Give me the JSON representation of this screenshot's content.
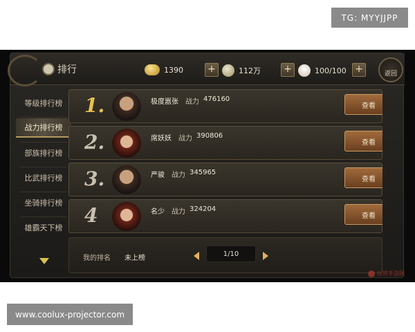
{
  "watermarks": {
    "top": "TG: MYYJJPP",
    "bottom": "www.coolux-projector.com"
  },
  "header": {
    "title": "排行",
    "back_label": "返回"
  },
  "resources": [
    {
      "icon": "gold-ingot-icon",
      "value": "1390"
    },
    {
      "icon": "coin-icon",
      "value": "112万"
    },
    {
      "icon": "bun-icon",
      "value": "100/100"
    }
  ],
  "plus_symbol": "+",
  "sidebar": {
    "items": [
      {
        "label": "等级排行榜",
        "active": false
      },
      {
        "label": "战力排行榜",
        "active": true
      },
      {
        "label": "部族排行榜",
        "active": false
      },
      {
        "label": "比武排行榜",
        "active": false
      },
      {
        "label": "坐骑排行榜",
        "active": false
      },
      {
        "label": "雄霸天下榜",
        "active": false
      }
    ]
  },
  "ranking": {
    "power_label": "战力",
    "view_label": "查看",
    "rows": [
      {
        "rank": "1.",
        "name": "极度嚣张",
        "power": "476160"
      },
      {
        "rank": "2.",
        "name": "席妖妖",
        "power": "390806"
      },
      {
        "rank": "3.",
        "name": "严骏",
        "power": "345965"
      },
      {
        "rank": "4",
        "name": "名少",
        "power": "324204"
      }
    ]
  },
  "footer": {
    "my_rank_label": "我的排名",
    "my_rank_value": "未上榜",
    "page": "1/10"
  },
  "corner_watermark": "玩转手游网",
  "colors": {
    "accent_gold": "#e8c34c",
    "button_brown": "#8a5530"
  }
}
